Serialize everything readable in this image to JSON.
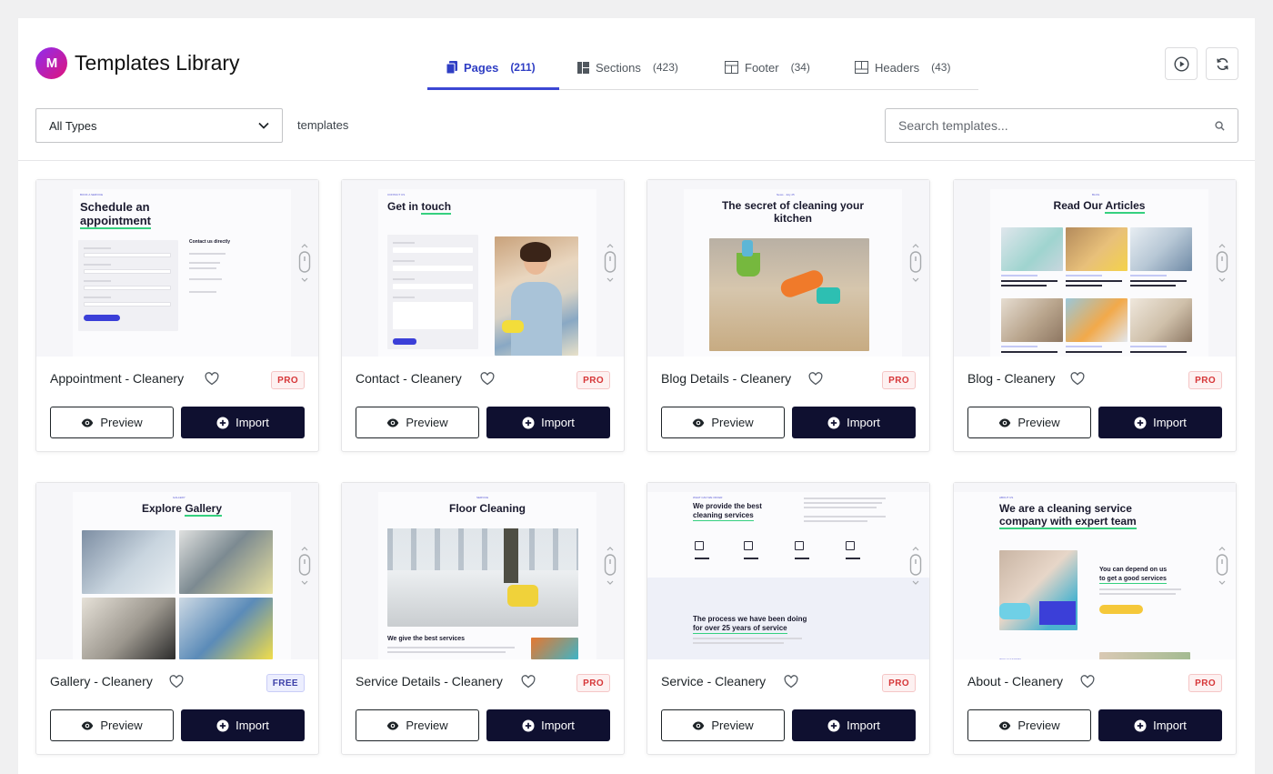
{
  "header": {
    "title": "Templates Library",
    "logo_text": "M",
    "accent": "#3b47d4",
    "tabs": [
      {
        "label": "Pages",
        "count": "(211)",
        "icon": "pages-icon",
        "active": true
      },
      {
        "label": "Sections",
        "count": "(423)",
        "icon": "sections-icon",
        "active": false
      },
      {
        "label": "Footer",
        "count": "(34)",
        "icon": "footer-icon",
        "active": false
      },
      {
        "label": "Headers",
        "count": "(43)",
        "icon": "headers-icon",
        "active": false
      }
    ],
    "actions": [
      "play-icon",
      "refresh-icon"
    ]
  },
  "filters": {
    "type_select": "All Types",
    "type_label": "templates",
    "search_placeholder": "Search templates..."
  },
  "buttons": {
    "preview": "Preview",
    "import": "Import"
  },
  "cards": [
    {
      "title": "Appointment - Cleanery",
      "badge": "PRO",
      "thumb_heading_1": "Schedule an",
      "thumb_heading_2": "appointment",
      "thumb_side": "Contact us directly"
    },
    {
      "title": "Contact - Cleanery",
      "badge": "PRO",
      "thumb_heading_1": "Get in",
      "thumb_heading_2": "touch"
    },
    {
      "title": "Blog Details - Cleanery",
      "badge": "PRO",
      "thumb_heading_1": "The secret of cleaning your",
      "thumb_heading_2": "kitchen"
    },
    {
      "title": "Blog - Cleanery",
      "badge": "PRO",
      "thumb_heading_1": "Read Our",
      "thumb_heading_2": "Articles"
    },
    {
      "title": "Gallery - Cleanery",
      "badge": "FREE",
      "thumb_heading_1": "Explore",
      "thumb_heading_2": "Gallery"
    },
    {
      "title": "Service Details - Cleanery",
      "badge": "PRO",
      "thumb_heading_1": "Floor Cleaning",
      "thumb_sub": "We give the best services"
    },
    {
      "title": "Service - Cleanery",
      "badge": "PRO",
      "thumb_heading_1": "We provide the best",
      "thumb_heading_2": "cleaning services",
      "thumb_sub_1": "The process we have been doing",
      "thumb_sub_2": "for over 25 years of service"
    },
    {
      "title": "About - Cleanery",
      "badge": "PRO",
      "thumb_heading_1": "We are a cleaning service",
      "thumb_heading_2": "company with expert team",
      "thumb_sub_1": "You can depend on us",
      "thumb_sub_2": "to get a good services"
    }
  ]
}
